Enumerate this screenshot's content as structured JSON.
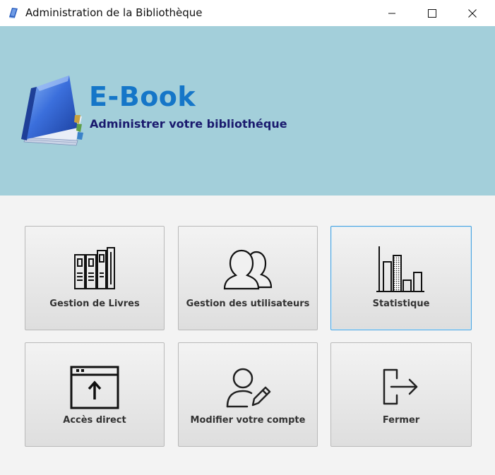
{
  "window": {
    "title": "Administration de la Bibliothèque"
  },
  "banner": {
    "brand": "E-Book",
    "subtitle": "Administrer votre bibliothéque",
    "background": "#a3cfda",
    "brand_color": "#1576c8"
  },
  "tiles": [
    {
      "label": "Gestion de Livres",
      "icon": "books-icon"
    },
    {
      "label": "Gestion des utilisateurs",
      "icon": "users-icon"
    },
    {
      "label": "Statistique",
      "icon": "bar-chart-icon"
    },
    {
      "label": "Accès direct",
      "icon": "window-upload-icon"
    },
    {
      "label": "Modifier votre compte",
      "icon": "user-edit-icon"
    },
    {
      "label": "Fermer",
      "icon": "exit-icon"
    }
  ]
}
